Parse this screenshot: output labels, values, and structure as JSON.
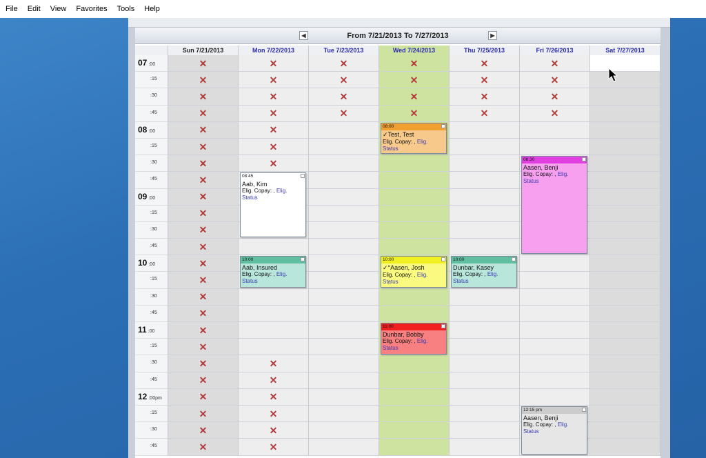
{
  "menu": [
    "File",
    "Edit",
    "View",
    "Favorites",
    "Tools",
    "Help"
  ],
  "calendar": {
    "range_title": "From 7/21/2013 To 7/27/2013",
    "prev_icon": "triangle-left-icon",
    "next_icon": "triangle-right-icon",
    "days": [
      {
        "label": "Sun 7/21/2013",
        "color": "#222222",
        "bg": "#dcdcdc"
      },
      {
        "label": "Mon 7/22/2013",
        "color": "#2b2bb0",
        "bg": "#eeeeee"
      },
      {
        "label": "Tue 7/23/2013",
        "color": "#2b2bb0",
        "bg": "#eeeeee"
      },
      {
        "label": "Wed 7/24/2013",
        "color": "#2b2bb0",
        "bg": "#cfe3a0"
      },
      {
        "label": "Thu 7/25/2013",
        "color": "#2b2bb0",
        "bg": "#eeeeee"
      },
      {
        "label": "Fri 7/26/2013",
        "color": "#2b2bb0",
        "bg": "#eeeeee"
      },
      {
        "label": "Sat 7/27/2013",
        "color": "#2b2bb0",
        "bg": "#dcdcdc"
      }
    ],
    "times": [
      {
        "hour": "07",
        "suffix": ":00",
        "min": ""
      },
      {
        "hour": "",
        "suffix": "",
        "min": ":15"
      },
      {
        "hour": "",
        "suffix": "",
        "min": ":30"
      },
      {
        "hour": "",
        "suffix": "",
        "min": ":45"
      },
      {
        "hour": "08",
        "suffix": ":00",
        "min": ""
      },
      {
        "hour": "",
        "suffix": "",
        "min": ":15"
      },
      {
        "hour": "",
        "suffix": "",
        "min": ":30"
      },
      {
        "hour": "",
        "suffix": "",
        "min": ":45"
      },
      {
        "hour": "09",
        "suffix": ":00",
        "min": ""
      },
      {
        "hour": "",
        "suffix": "",
        "min": ":15"
      },
      {
        "hour": "",
        "suffix": "",
        "min": ":30"
      },
      {
        "hour": "",
        "suffix": "",
        "min": ":45"
      },
      {
        "hour": "10",
        "suffix": ":00",
        "min": ""
      },
      {
        "hour": "",
        "suffix": "",
        "min": ":15"
      },
      {
        "hour": "",
        "suffix": "",
        "min": ":30"
      },
      {
        "hour": "",
        "suffix": "",
        "min": ":45"
      },
      {
        "hour": "11",
        "suffix": ":00",
        "min": ""
      },
      {
        "hour": "",
        "suffix": "",
        "min": ":15"
      },
      {
        "hour": "",
        "suffix": "",
        "min": ":30"
      },
      {
        "hour": "",
        "suffix": "",
        "min": ":45"
      },
      {
        "hour": "12",
        "suffix": ":00pm",
        "min": ""
      },
      {
        "hour": "",
        "suffix": "",
        "min": ":15"
      },
      {
        "hour": "",
        "suffix": "",
        "min": ":30"
      },
      {
        "hour": "",
        "suffix": "",
        "min": ":45"
      }
    ],
    "blocked": {
      "0": [
        0,
        1,
        2,
        3,
        4,
        5,
        6,
        7,
        8,
        9,
        10,
        11,
        12,
        13,
        14,
        15,
        16,
        17,
        18,
        19,
        20,
        21,
        22,
        23
      ],
      "1": [
        0,
        1,
        2,
        3,
        4,
        5,
        6,
        18,
        19,
        20,
        21,
        22,
        23
      ],
      "2": [
        0,
        1,
        2,
        3
      ],
      "3": [
        0,
        1,
        2,
        3
      ],
      "4": [
        0,
        1,
        2,
        3
      ],
      "5": [
        0,
        1,
        2,
        3
      ]
    },
    "appointments": [
      {
        "day": 3,
        "slot": 4,
        "span": 2,
        "time": "08:00",
        "name": "✓Test, Test",
        "copay": "Elig. Copay: ,",
        "elig": "Elig.",
        "status": "Status",
        "head": "#f0a030",
        "body": "#f7c98a"
      },
      {
        "day": 1,
        "slot": 7,
        "span": 4,
        "time": "08:45",
        "name": "Aab, Kim",
        "copay": "Elig. Copay: ,",
        "elig": "Elig.",
        "status": "Status",
        "head": "#ffffff",
        "body": "#ffffff"
      },
      {
        "day": 5,
        "slot": 6,
        "span": 6,
        "time": "08:30",
        "name": "Aasen, Benji",
        "copay": "Elig. Copay: ,",
        "elig": "Elig.",
        "status": "Status",
        "head": "#e040e0",
        "body": "#f7a0f0"
      },
      {
        "day": 1,
        "slot": 12,
        "span": 2,
        "time": "10:00",
        "name": "Aab, Insured",
        "copay": "Elig. Copay: ,",
        "elig": "Elig.",
        "status": "Status",
        "head": "#5fbfa0",
        "body": "#b8e6da"
      },
      {
        "day": 3,
        "slot": 12,
        "span": 2,
        "time": "10:00",
        "name": "✓°Aasen, Josh",
        "copay": "Elig. Copay: ,",
        "elig": "Elig.",
        "status": "Status",
        "head": "#f2f020",
        "body": "#fafa80"
      },
      {
        "day": 4,
        "slot": 12,
        "span": 2,
        "time": "10:00",
        "name": "Dunbar, Kasey",
        "copay": "Elig. Copay: ,",
        "elig": "Elig.",
        "status": "Status",
        "head": "#5fbfa0",
        "body": "#b8e6da"
      },
      {
        "day": 3,
        "slot": 16,
        "span": 2,
        "time": "11:00",
        "name": "Dunbar, Bobby",
        "copay": "Elig. Copay: ,",
        "elig": "Elig.",
        "status": "Status",
        "head": "#f02020",
        "body": "#f88080"
      },
      {
        "day": 5,
        "slot": 21,
        "span": 3,
        "time": "12:15 pm",
        "name": "Aasen, Benji",
        "copay": "Elig. Copay: ,",
        "elig": "Elig.",
        "status": "Status",
        "head": "#cccccc",
        "body": "#e6e6e6"
      }
    ]
  }
}
